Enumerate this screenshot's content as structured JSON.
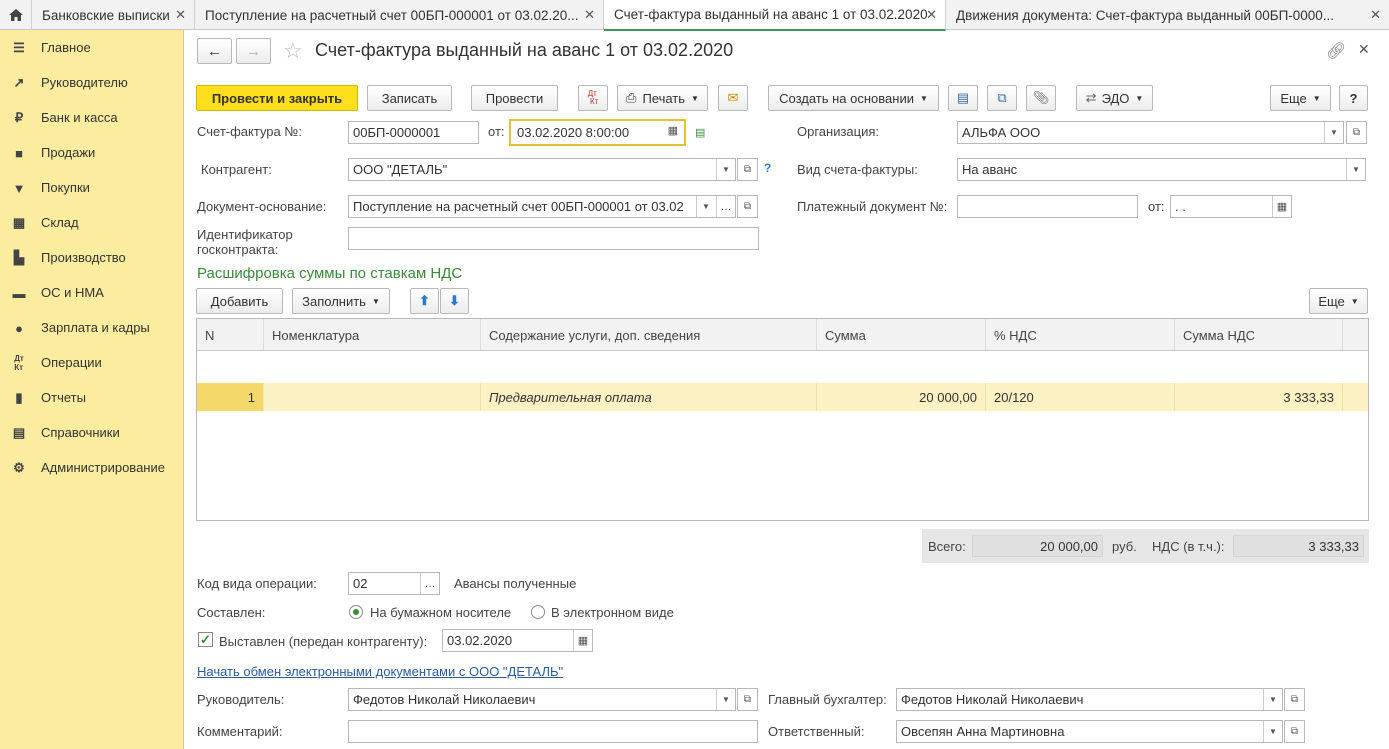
{
  "tabs": [
    {
      "label": "Банковские выписки"
    },
    {
      "label": "Поступление на расчетный счет 00БП-000001 от 03.02.20..."
    },
    {
      "label": "Счет-фактура выданный на аванс 1 от 03.02.2020"
    },
    {
      "label": "Движения документа: Счет-фактура выданный 00БП-0000..."
    }
  ],
  "sidebar": {
    "items": [
      {
        "label": "Главное",
        "icon": "menu-icon"
      },
      {
        "label": "Руководителю",
        "icon": "trend-icon"
      },
      {
        "label": "Банк и касса",
        "icon": "ruble-icon"
      },
      {
        "label": "Продажи",
        "icon": "bag-icon"
      },
      {
        "label": "Покупки",
        "icon": "cart-icon"
      },
      {
        "label": "Склад",
        "icon": "grid-icon"
      },
      {
        "label": "Производство",
        "icon": "factory-icon"
      },
      {
        "label": "ОС и НМА",
        "icon": "truck-icon"
      },
      {
        "label": "Зарплата и кадры",
        "icon": "person-icon"
      },
      {
        "label": "Операции",
        "icon": "dt-kt-icon"
      },
      {
        "label": "Отчеты",
        "icon": "bar-chart-icon"
      },
      {
        "label": "Справочники",
        "icon": "book-icon"
      },
      {
        "label": "Администрирование",
        "icon": "gear-icon"
      }
    ]
  },
  "header": {
    "title": "Счет-фактура выданный на аванс 1 от 03.02.2020"
  },
  "toolbar": {
    "post_close": "Провести и закрыть",
    "save": "Записать",
    "post": "Провести",
    "print": "Печать",
    "create_based": "Создать на основании",
    "edo": "ЭДО",
    "more": "Еще",
    "help": "?"
  },
  "form": {
    "invoice_label": "Счет-фактура №:",
    "invoice_number": "00БП-0000001",
    "date_label": "от:",
    "date_value": "03.02.2020  8:00:00",
    "org_label": "Организация:",
    "org_value": "АЛЬФА ООО",
    "contractor_label": "Контрагент:",
    "contractor_value": "ООО \"ДЕТАЛЬ\"",
    "invoice_type_label": "Вид счета-фактуры:",
    "invoice_type_value": "На аванс",
    "base_doc_label": "Документ-основание:",
    "base_doc_value": "Поступление на расчетный счет 00БП-000001 от 03.02",
    "payment_doc_label": "Платежный документ №:",
    "payment_doc_value": "",
    "payment_date_label": "от:",
    "payment_date_value": " .  .",
    "gov_id_label_1": "Идентификатор",
    "gov_id_label_2": "госконтракта:",
    "gov_id_value": ""
  },
  "section": {
    "title": "Расшифровка суммы по ставкам НДС",
    "add": "Добавить",
    "fill": "Заполнить",
    "more": "Еще"
  },
  "table": {
    "headers": [
      "N",
      "Номенклатура",
      "Содержание услуги, доп. сведения",
      "Сумма",
      "% НДС",
      "Сумма НДС"
    ],
    "rows": [
      {
        "n": "1",
        "nomenclature": "",
        "content": "Предварительная оплата",
        "sum": "20 000,00",
        "vat_rate": "20/120",
        "vat_sum": "3 333,33"
      }
    ]
  },
  "totals": {
    "total_label": "Всего:",
    "total_value": "20 000,00",
    "currency": "руб.",
    "vat_label": "НДС (в т.ч.):",
    "vat_value": "3 333,33"
  },
  "bottom": {
    "op_code_label": "Код вида операции:",
    "op_code_value": "02",
    "op_code_desc": "Авансы полученные",
    "composed_label": "Составлен:",
    "paper_label": "На бумажном носителе",
    "electronic_label": "В электронном виде",
    "issued_label": "Выставлен (передан контрагенту):",
    "issued_date": "03.02.2020",
    "edo_link": "Начать обмен электронными документами с ООО \"ДЕТАЛЬ\"",
    "manager_label": "Руководитель:",
    "manager_value": "Федотов Николай Николаевич",
    "chief_acc_label": "Главный бухгалтер:",
    "chief_acc_value": "Федотов Николай Николаевич",
    "comment_label": "Комментарий:",
    "comment_value": "",
    "responsible_label": "Ответственный:",
    "responsible_value": "Овсепян Анна Мартиновна"
  }
}
